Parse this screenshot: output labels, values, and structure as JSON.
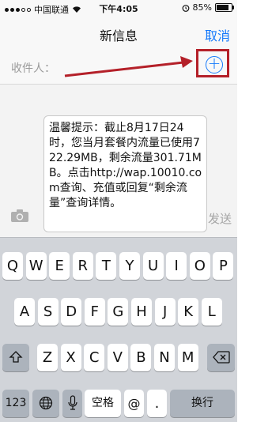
{
  "status_bar": {
    "carrier": "中国联通",
    "time": "下午4:05",
    "battery_text": "85%",
    "battery_level": 0.85,
    "icons": [
      "signal-dots-icon",
      "wifi-icon",
      "alarm-icon",
      "battery-icon"
    ]
  },
  "nav": {
    "title": "新信息",
    "cancel_label": "取消"
  },
  "recipients": {
    "label": "收件人：",
    "add_icon": "plus-circle-icon"
  },
  "message": {
    "draft_text": "温馨提示：截止8月17日24时，您当月套餐内流量已使用722.29MB，剩余流量301.71MB。点击http://wap.10010.com查询、充值或回复“剩余流量”查询详情。",
    "send_label": "发送",
    "camera_icon": "camera-icon"
  },
  "keyboard": {
    "row1": [
      "Q",
      "W",
      "E",
      "R",
      "T",
      "Y",
      "U",
      "I",
      "O",
      "P"
    ],
    "row2": [
      "A",
      "S",
      "D",
      "F",
      "G",
      "H",
      "J",
      "K",
      "L"
    ],
    "row3": [
      "Z",
      "X",
      "C",
      "V",
      "B",
      "N",
      "M"
    ],
    "numbers_label": "123",
    "space_label": "空格",
    "at_label": "@",
    "return_label": "换行",
    "icons": [
      "shift-icon",
      "backspace-icon",
      "globe-icon",
      "microphone-icon"
    ]
  },
  "colors": {
    "accent_blue": "#1479fb",
    "annotation_red": "#b42029"
  }
}
